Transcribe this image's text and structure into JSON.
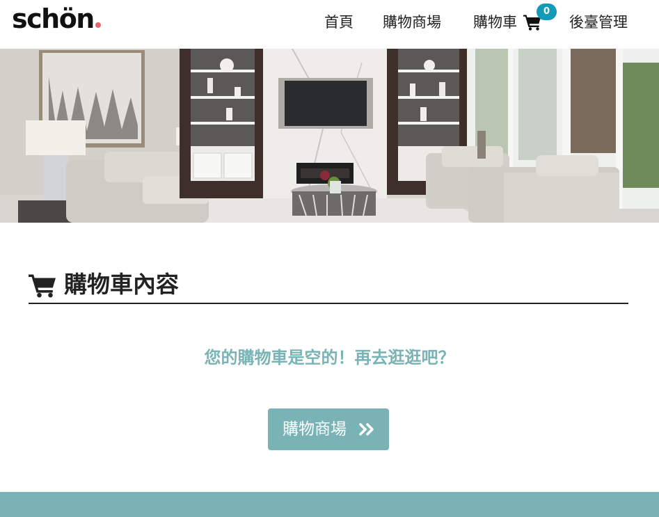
{
  "brand": {
    "logo_text": "schön",
    "accent_color": "#e8636b"
  },
  "nav": {
    "home_label": "首頁",
    "shop_label": "購物商場",
    "cart_label": "購物車",
    "cart_count": "0",
    "admin_label": "後臺管理",
    "badge_color": "#139ab6"
  },
  "hero": {
    "image_subject": "living-room-photo"
  },
  "cart_section": {
    "title": "購物車內容",
    "empty_message": "您的購物車是空的！再去逛逛吧？",
    "shop_button_label": "購物商場"
  },
  "theme": {
    "primary_color": "#7ab3b5",
    "text_color": "#222222"
  },
  "icons": {
    "nav_cart": "shopping-cart-icon",
    "title_cart": "shopping-cart-icon",
    "button_arrow": "double-chevron-right-icon"
  }
}
